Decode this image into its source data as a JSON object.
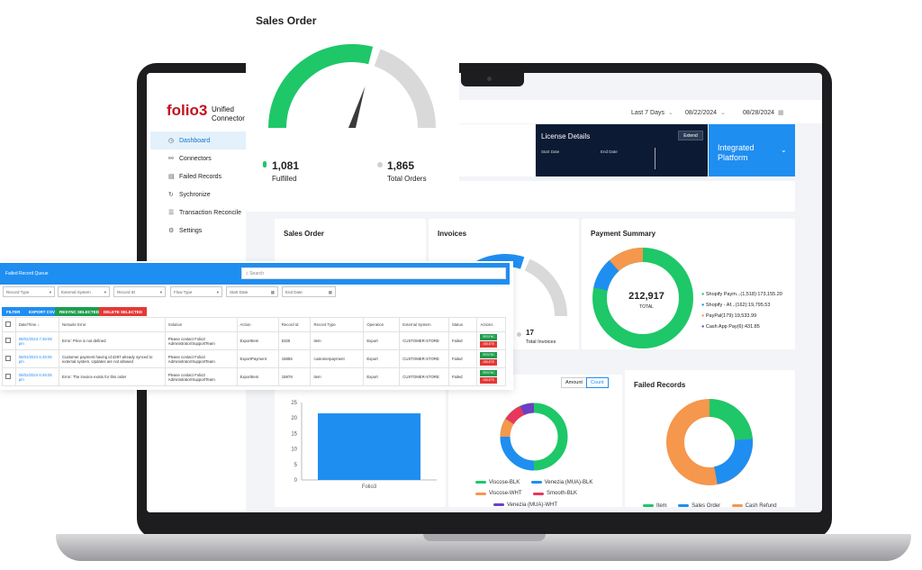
{
  "app": {
    "brand": "folio3",
    "brand_sub_line1": "Unified",
    "brand_sub_line2": "Connector"
  },
  "sidebar": {
    "items": [
      {
        "label": "Dashboard",
        "icon": "dashboard-icon",
        "active": true
      },
      {
        "label": "Connectors",
        "icon": "link-icon"
      },
      {
        "label": "Failed Records",
        "icon": "document-icon"
      },
      {
        "label": "Sychronize",
        "icon": "sync-icon"
      },
      {
        "label": "Transaction Reconcile",
        "icon": "list-icon"
      },
      {
        "label": "Settings",
        "icon": "gear-icon"
      }
    ]
  },
  "topbar": {
    "range": "Last 7 Days",
    "start_date": "08/22/2024",
    "end_date": "08/28/2024"
  },
  "license": {
    "title": "License Details",
    "extend_label": "Extend",
    "start_label": "Start Date",
    "end_label": "End Date"
  },
  "integrated": {
    "line1": "Integrated",
    "line2": "Platform"
  },
  "sales_order": {
    "title": "Sales Order",
    "fulfilled_value": "1,081",
    "fulfilled_label": "Fulfilled",
    "total_value": "1,865",
    "total_label": "Total Orders",
    "fulfilled_fraction": 0.58,
    "colors": {
      "fill": "#1ec768",
      "rest": "#d9d9d9"
    }
  },
  "inner_sales_order": {
    "title": "Sales Order"
  },
  "invoices": {
    "title": "Invoices",
    "total_value": "17",
    "total_label": "Total Invoices",
    "fraction": 0.6,
    "colors": {
      "fill": "#1f8ef1",
      "rest": "#d9d9d9"
    }
  },
  "payment_summary": {
    "title": "Payment Summary",
    "total_value": "212,917",
    "total_label": "TOTAL",
    "legend": [
      {
        "label": "Shopify Paym...(1,518):173,155.20",
        "color": "#1ec768"
      },
      {
        "label": "Shopify - Af...(162):19,795.53",
        "color": "#1f8ef1"
      },
      {
        "label": "PayPal(179):19,533.99",
        "color": "#f5974d"
      },
      {
        "label": "Cash App Pay(6):431.85",
        "color": "#6c3fc4"
      }
    ]
  },
  "bar_chart": {
    "chart_data": {
      "type": "bar",
      "categories": [
        "Folio3"
      ],
      "values": [
        21.5
      ],
      "ylim": [
        0,
        25
      ],
      "yticks": [
        "0",
        "5",
        "10",
        "15",
        "20",
        "25"
      ],
      "color": "#1f8ef1"
    }
  },
  "ring_chart": {
    "toggle_amount": "Amount",
    "toggle_count": "Count",
    "legend": [
      {
        "label": "Viscose-BLK",
        "color": "#1ec768"
      },
      {
        "label": "Venezia (MUA)-BLK",
        "color": "#1f8ef1"
      },
      {
        "label": "Viscose-WHT",
        "color": "#f5974d"
      },
      {
        "label": "Smooth-BLK",
        "color": "#e8365d"
      },
      {
        "label": "Venezia (MUA)-WHT",
        "color": "#6c3fc4"
      }
    ]
  },
  "failed_records": {
    "title": "Failed Records",
    "legend": [
      {
        "label": "Item",
        "color": "#1ec768"
      },
      {
        "label": "Sales Order",
        "color": "#1f8ef1"
      },
      {
        "label": "Cash Refund",
        "color": "#f5974d"
      }
    ]
  },
  "queue": {
    "title": "Failed Record Queue",
    "search_placeholder": "Search",
    "filters": [
      "Record Type",
      "External System",
      "Record ID",
      "Flow Type",
      "Start Date",
      "End Date"
    ],
    "buttons": {
      "filter": "FILTER",
      "export": "EXPORT CSV",
      "resync": "RESYNC SELECTED",
      "delete": "DELETE SELECTED"
    },
    "columns": [
      "Date/Time",
      "Netsuite Error",
      "Solution",
      "Action",
      "Record Id",
      "Record Type",
      "Operation",
      "External System",
      "Status",
      "Actions"
    ],
    "rows": [
      {
        "date": "08/02/2024 7:49:08 pm",
        "error": "Error: Price is not defined",
        "solution": "Please contact Folio3 Administrator/SupportTeam",
        "action": "ExportItem",
        "id": "5325",
        "type": "item",
        "operation": "Export",
        "system": "CUSTOMER-STORE",
        "status": "Failed"
      },
      {
        "date": "08/02/2024 6:49:05 pm",
        "error": "Customer payment having id:4297 already synced to external system. Updates are not allowed",
        "solution": "Please contact Folio3 Administrator/SupportTeam",
        "action": "ExportPayment",
        "id": "15855",
        "type": "customerpayment",
        "operation": "Export",
        "system": "CUSTOMER-STORE",
        "status": "Failed"
      },
      {
        "date": "08/02/2024 6:49:05 pm",
        "error": "Error: The invoice exists for this order",
        "solution": "Please contact Folio3 Administrator/SupportTeam",
        "action": "ExportItem",
        "id": "15978",
        "type": "item",
        "operation": "Export",
        "system": "CUSTOMER-STORE",
        "status": "Failed"
      }
    ],
    "resync_label": "RESYNC",
    "delete_label": "DELETE"
  }
}
